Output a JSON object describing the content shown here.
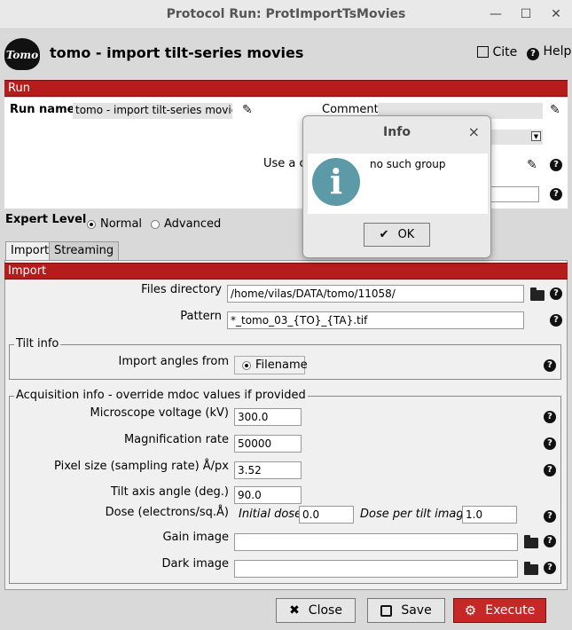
{
  "window": {
    "title": "Protocol Run: ProtImportTsMovies",
    "minimize": "—",
    "maximize": "☐",
    "close": "✕"
  },
  "header": {
    "logo_text": "Tomo",
    "protocol_title": "tomo - import tilt-series movies",
    "cite_label": "Cite",
    "help_label": "Help"
  },
  "run_section": {
    "title": "Run",
    "run_name_label": "Run name",
    "run_name_value": "tomo - import tilt-series movies",
    "comment_label": "Comment",
    "comment_value": "",
    "use_a_label": "Use a c"
  },
  "expert_level": {
    "label": "Expert Level",
    "options": [
      "Normal",
      "Advanced"
    ],
    "selected": "Normal"
  },
  "tabs": [
    {
      "label": "Import"
    },
    {
      "label": "Streaming"
    }
  ],
  "import_section": {
    "title": "Import",
    "files_directory_label": "Files directory",
    "files_directory_value": "/home/vilas/DATA/tomo/11058/",
    "pattern_label": "Pattern",
    "pattern_value": "*_tomo_03_{TO}_{TA}.tif"
  },
  "tilt_info": {
    "legend": "Tilt info",
    "import_angles_label": "Import angles from",
    "import_angles_value": "Filename"
  },
  "acquisition": {
    "legend": "Acquisition info - override mdoc values if provided",
    "voltage_label": "Microscope voltage (kV)",
    "voltage_value": "300.0",
    "magnification_label": "Magnification rate",
    "magnification_value": "50000",
    "pixel_size_label": "Pixel size (sampling rate) Å/px",
    "pixel_size_value": "3.52",
    "tilt_axis_label": "Tilt axis angle (deg.)",
    "tilt_axis_value": "90.0",
    "dose_label": "Dose (electrons/sq.Å)",
    "initial_dose_label": "Initial dose",
    "initial_dose_value": "0.0",
    "dose_per_tilt_label": "Dose per tilt image",
    "dose_per_tilt_value": "1.0",
    "gain_label": "Gain image",
    "gain_value": "",
    "dark_label": "Dark image",
    "dark_value": ""
  },
  "footer": {
    "close_label": "Close",
    "save_label": "Save",
    "execute_label": "Execute"
  },
  "dialog": {
    "title": "Info",
    "message": "no such group",
    "ok_label": "OK",
    "close_glyph": "×"
  },
  "colors": {
    "section_bar": "#b71c1c",
    "execute_button": "#c62828",
    "info_icon": "#5b9aa6"
  }
}
